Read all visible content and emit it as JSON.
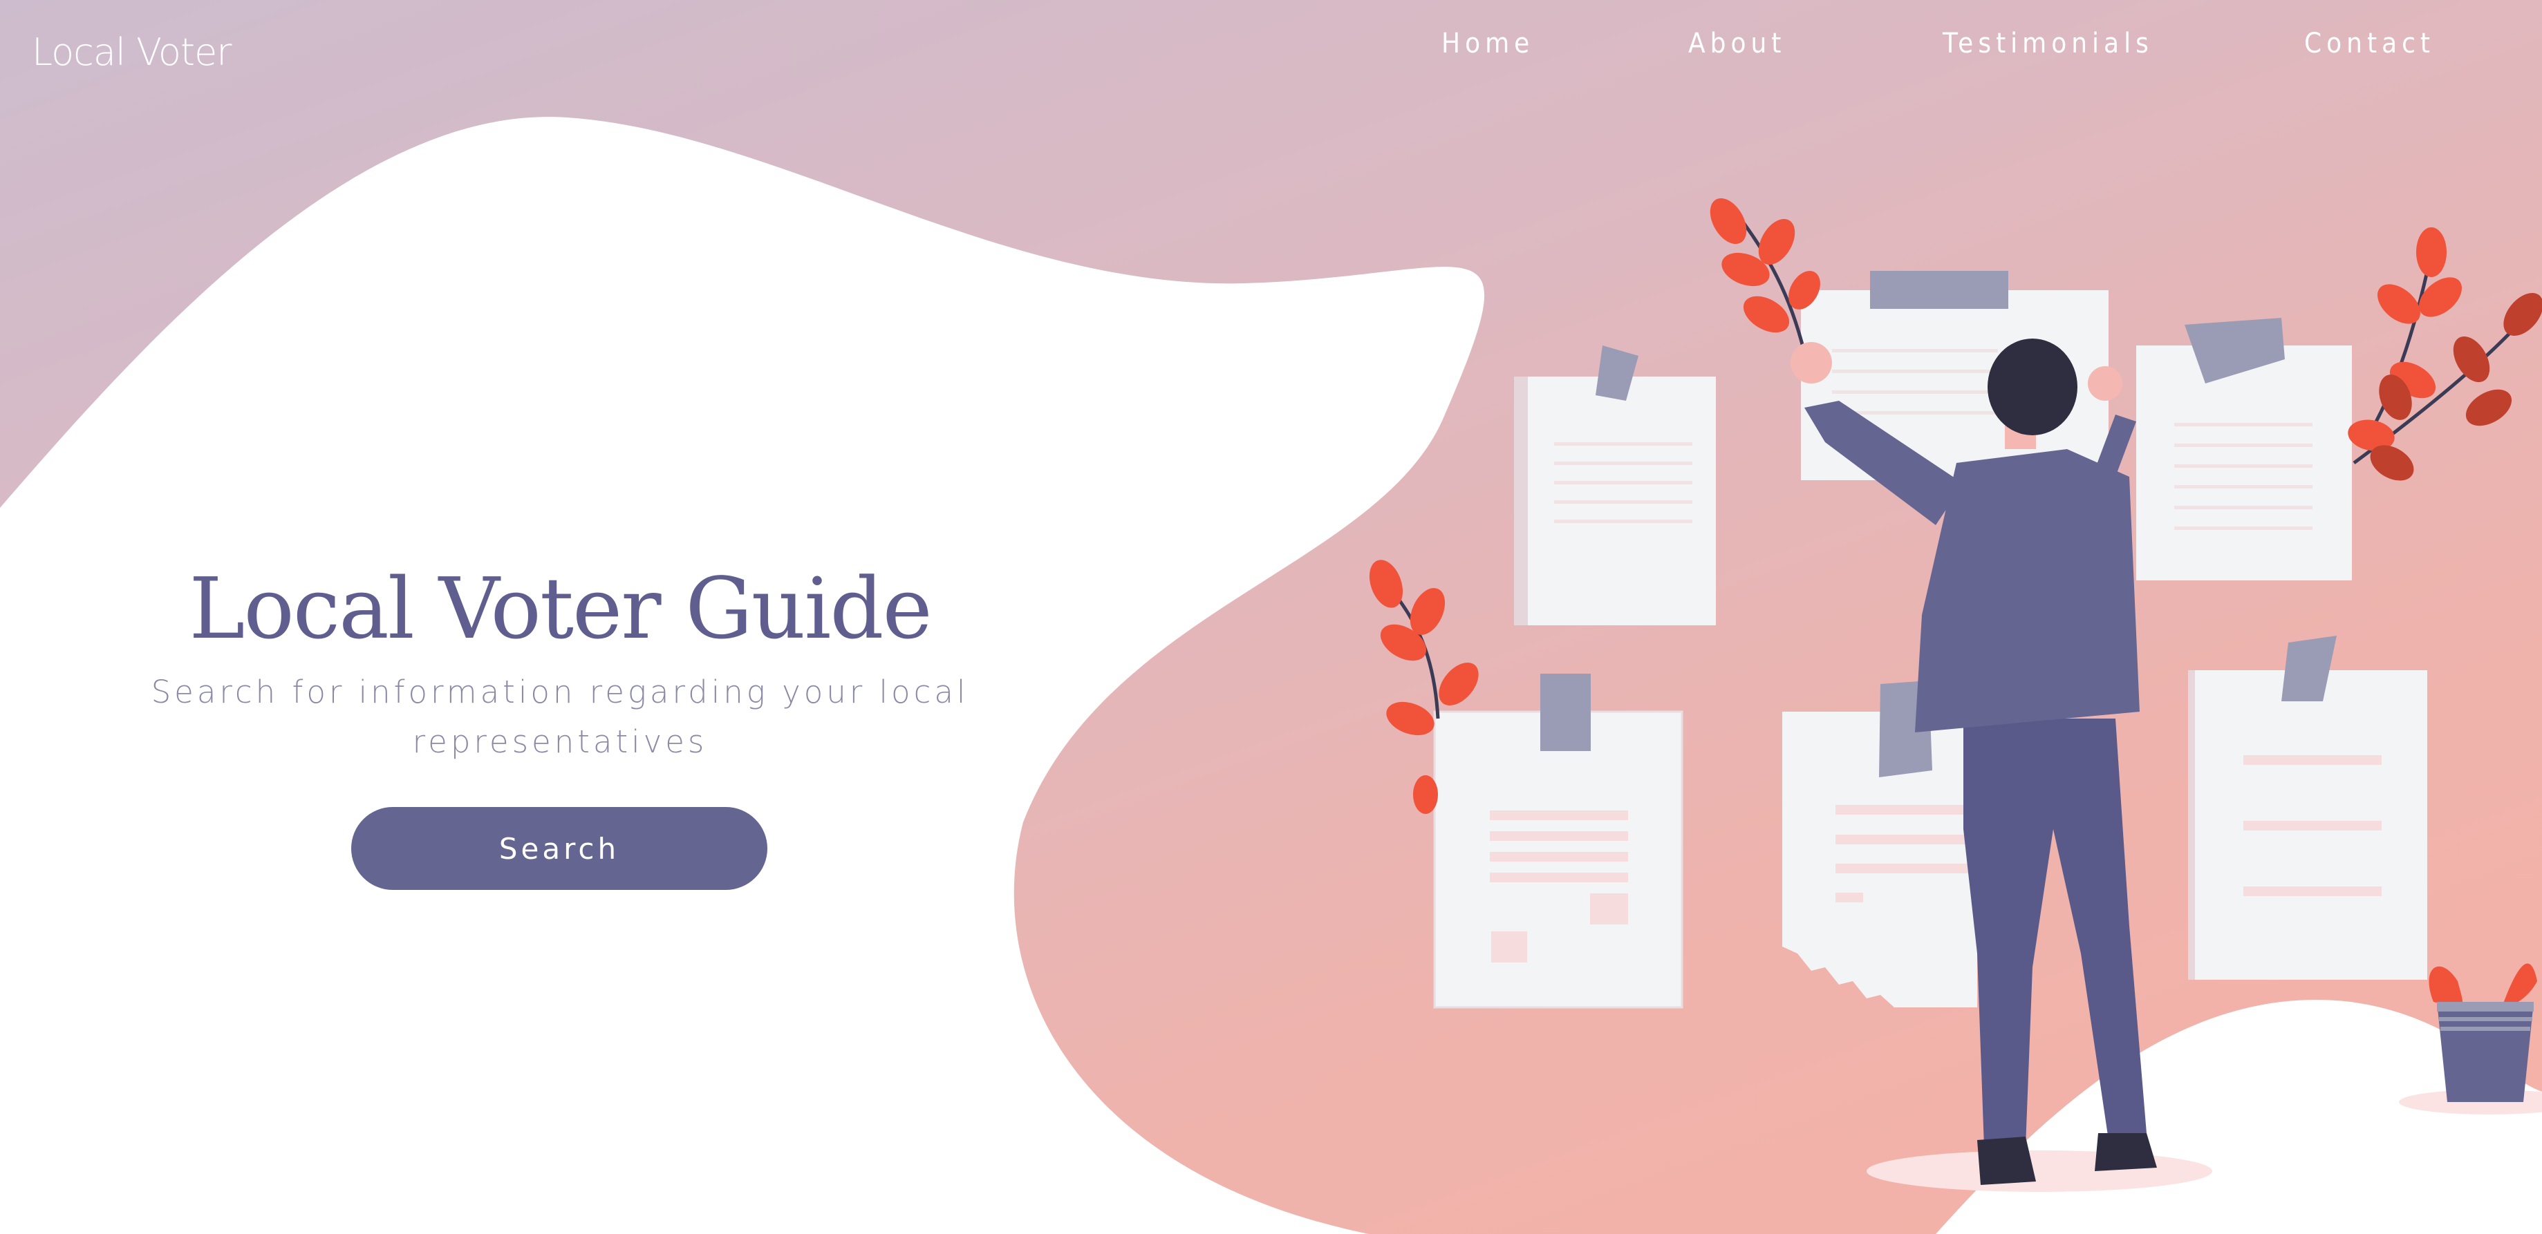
{
  "brand": {
    "name": "Local Voter"
  },
  "nav": {
    "items": [
      {
        "label": "Home"
      },
      {
        "label": "About"
      },
      {
        "label": "Testimonials"
      },
      {
        "label": "Contact"
      }
    ]
  },
  "hero": {
    "title": "Local Voter Guide",
    "subtitle": "Search for information regarding your local representatives",
    "search_button": "Search"
  },
  "colors": {
    "accent": "#656592",
    "leaf": "#f0533a",
    "paper": "#f3f4f6",
    "tape": "#9a9bb4"
  },
  "illustration": {
    "subject": "man-pinning-notes-to-wall",
    "icon": "person-with-notes-illustration"
  }
}
